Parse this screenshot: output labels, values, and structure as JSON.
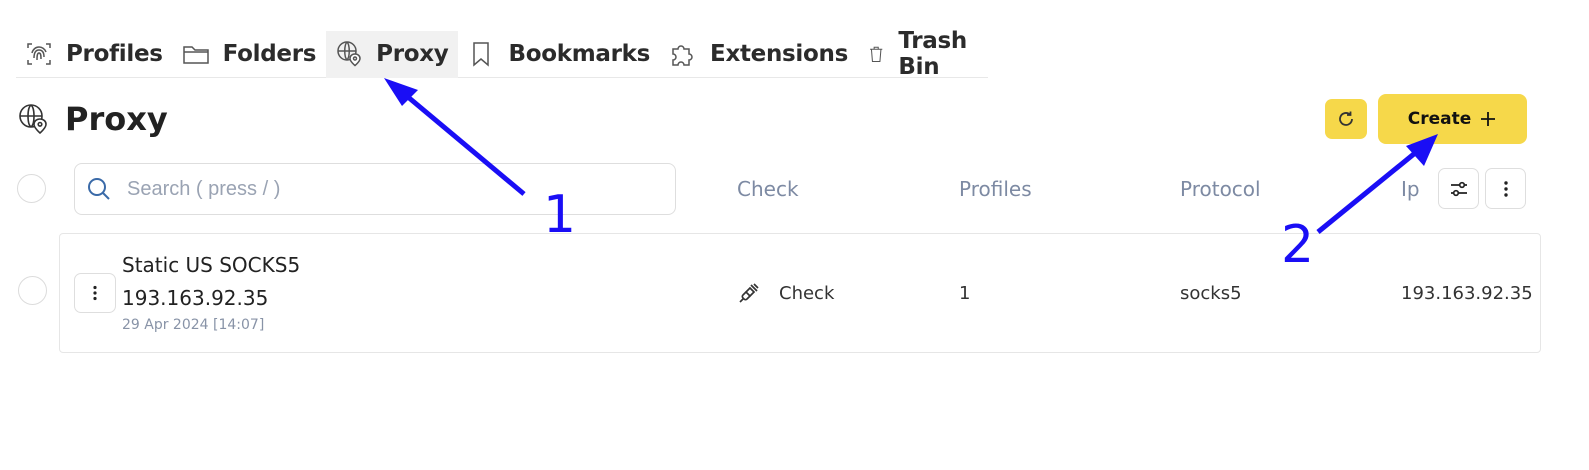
{
  "nav": {
    "tabs": [
      {
        "label": "Profiles",
        "icon": "fingerprint-icon"
      },
      {
        "label": "Folders",
        "icon": "folder-icon"
      },
      {
        "label": "Proxy",
        "icon": "globe-pin-icon",
        "active": true
      },
      {
        "label": "Bookmarks",
        "icon": "bookmark-icon"
      },
      {
        "label": "Extensions",
        "icon": "puzzle-icon"
      },
      {
        "label": "Trash Bin",
        "icon": "trash-icon"
      }
    ]
  },
  "header": {
    "title": "Proxy",
    "icon": "globe-pin-icon",
    "refresh_icon": "refresh-icon",
    "create_label": "Create",
    "create_icon": "plus-icon"
  },
  "toolbar": {
    "search_placeholder": "Search ( press / )",
    "search_value": ""
  },
  "table": {
    "columns": [
      "Check",
      "Profiles",
      "Protocol",
      "Ip"
    ],
    "rows": [
      {
        "name": "Static US SOCKS5",
        "host": "193.163.92.35",
        "created": "29 Apr 2024 [14:07]",
        "check": "Check",
        "profiles": "1",
        "protocol": "socks5",
        "ip": "193.163.92.35"
      }
    ]
  },
  "annotations": {
    "label_1": "1",
    "label_2": "2",
    "arrow_color": "#1a0ef5"
  },
  "colors": {
    "accent": "#f6d84a",
    "muted_text": "#7d8aa3"
  }
}
